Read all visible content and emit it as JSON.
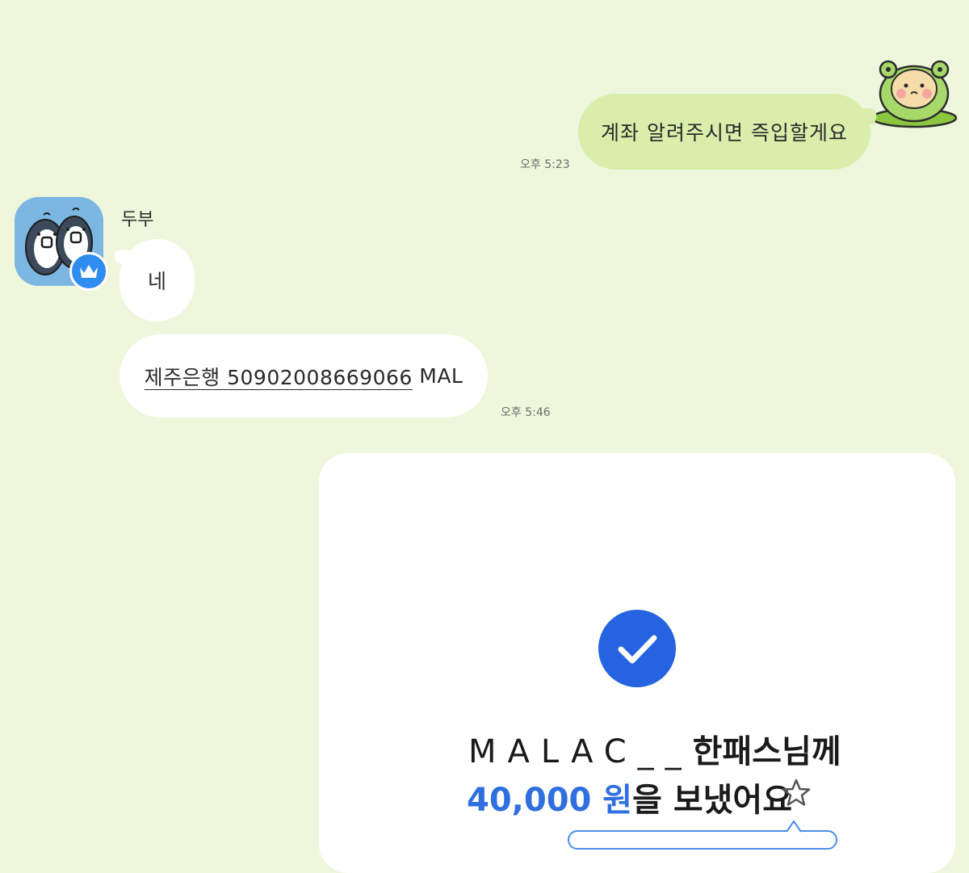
{
  "messages": {
    "outgoing_1": {
      "text": "계좌 알려주시면 즉입할게요",
      "time": "오후 5:23"
    },
    "sender_name": "두부",
    "incoming_1": {
      "text": "네"
    },
    "incoming_2": {
      "account": "제주은행 50902008669066",
      "suffix": " MAL",
      "time": "오후 5:46"
    }
  },
  "transfer_card": {
    "recipient": "MALAC__",
    "recipient_suffix": "한패스님께",
    "amount": "40,000 원",
    "amount_suffix": "을 보냈어요"
  },
  "colors": {
    "background": "#eef6dc",
    "outgoing_bubble": "#d9eeab",
    "incoming_bubble": "#ffffff",
    "accent_blue": "#2563e0",
    "amount_blue": "#2f6fe0",
    "badge_blue": "#2f8cf0"
  },
  "icons": {
    "frog_avatar": "frog-character-icon",
    "penguin_avatar": "penguin-profile-icon",
    "badge": "crown-icon",
    "check": "check-icon",
    "favorite": "star-icon"
  }
}
